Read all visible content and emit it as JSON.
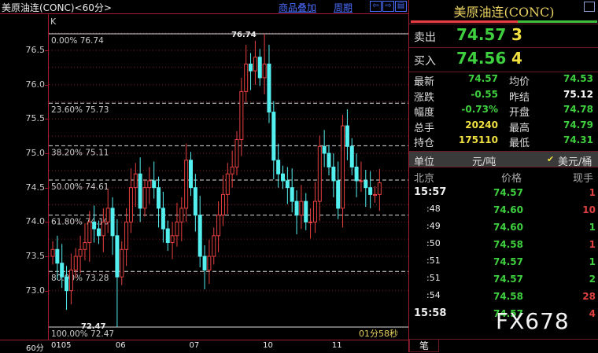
{
  "header": {
    "title": "美原油连(CONC)<60分>",
    "overlay_link": "商品叠加",
    "period_link": "周期",
    "nav": [
      "⇦",
      "⇨",
      "▤"
    ]
  },
  "chart": {
    "indicator_label": "K",
    "y_ticks": [
      "76.5",
      "76.0",
      "75.5",
      "75.0",
      "74.5",
      "74.0",
      "73.5",
      "73.0"
    ],
    "y_tick_values": [
      76.5,
      76.0,
      75.5,
      75.0,
      74.5,
      74.0,
      73.5,
      73.0
    ],
    "fib_levels": [
      {
        "label": "0.00% 76.74",
        "price": 76.74
      },
      {
        "label": "23.60% 75.73",
        "price": 75.73
      },
      {
        "label": "38.20% 75.11",
        "price": 75.11
      },
      {
        "label": "50.00% 74.61",
        "price": 74.61
      },
      {
        "label": "61.80% 74.10",
        "price": 74.1
      },
      {
        "label": "80.90% 73.28",
        "price": 73.28
      },
      {
        "label": "100.00% 72.47",
        "price": 72.47
      }
    ],
    "high_marker": "76.74",
    "low_marker": "72.47",
    "high_price": 76.74,
    "low_price": 72.47,
    "high_index": 46,
    "low_index": 14,
    "countdown": "01分58秒",
    "period": "60分",
    "x_labels": [
      {
        "text": "0105",
        "index": 0
      },
      {
        "text": "06",
        "index": 14
      },
      {
        "text": "07",
        "index": 30
      },
      {
        "text": "10",
        "index": 46
      },
      {
        "text": "11",
        "index": 61
      }
    ],
    "open0": 73.5,
    "closes": [
      73.6,
      73.4,
      73.2,
      73.0,
      73.3,
      73.5,
      73.6,
      73.7,
      74.0,
      73.9,
      73.8,
      74.0,
      74.2,
      73.8,
      73.2,
      73.6,
      74.0,
      74.5,
      74.7,
      74.2,
      74.5,
      74.6,
      74.5,
      74.2,
      73.9,
      73.7,
      73.8,
      74.0,
      74.2,
      74.9,
      74.5,
      74.1,
      73.5,
      73.3,
      73.5,
      73.8,
      74.1,
      74.4,
      74.7,
      74.8,
      75.2,
      75.9,
      76.3,
      76.2,
      76.4,
      76.1,
      76.3,
      75.6,
      74.9,
      74.7,
      74.6,
      74.5,
      74.3,
      74.1,
      74.3,
      74.0,
      74.0,
      74.3,
      75.1,
      75.0,
      74.8,
      74.6,
      74.2,
      75.4,
      75.1,
      74.8,
      74.6,
      74.6,
      74.5,
      74.4,
      74.4,
      74.57
    ],
    "up_color": "#e84040",
    "down_color": "#54f0f0"
  },
  "quote": {
    "name": "美原油连(CONC)",
    "ask_label": "卖出",
    "ask_price": "74.57",
    "ask_vol": "3",
    "bid_label": "买入",
    "bid_price": "74.56",
    "bid_vol": "4",
    "stats": [
      {
        "l1": "最新",
        "v1": "74.57",
        "c1": "g",
        "l2": "均价",
        "v2": "74.53",
        "c2": "g"
      },
      {
        "l1": "涨跌",
        "v1": "-0.55",
        "c1": "g",
        "l2": "昨结",
        "v2": "75.12",
        "c2": "w"
      },
      {
        "l1": "幅度",
        "v1": "-0.73%",
        "c1": "g",
        "l2": "开盘",
        "v2": "74.78",
        "c2": "g"
      },
      {
        "l1": "总手",
        "v1": "20240",
        "c1": "y",
        "l2": "最高",
        "v2": "74.79",
        "c2": "g"
      },
      {
        "l1": "持仓",
        "v1": "175110",
        "c1": "y",
        "l2": "最低",
        "v2": "74.31",
        "c2": "g"
      }
    ],
    "unit_label": "单位",
    "unit_opt1": "元/吨",
    "unit_opt2": "美元/桶",
    "check": "✔",
    "ticks_header": [
      "北京",
      "价格",
      "现手"
    ],
    "ticks": [
      {
        "t": "15:57",
        "p": "74.57",
        "v": "1",
        "vc": "r",
        "big": true
      },
      {
        "t": ":48",
        "p": "74.60",
        "v": "10",
        "vc": "r",
        "big": false
      },
      {
        "t": ":49",
        "p": "74.60",
        "v": "1",
        "vc": "g",
        "big": false
      },
      {
        "t": ":50",
        "p": "74.58",
        "v": "1",
        "vc": "r",
        "big": false
      },
      {
        "t": ":51",
        "p": "74.57",
        "v": "1",
        "vc": "g",
        "big": false
      },
      {
        "t": ":51",
        "p": "74.57",
        "v": "2",
        "vc": "g",
        "big": false
      },
      {
        "t": ":54",
        "p": "74.58",
        "v": "28",
        "vc": "r",
        "big": false
      },
      {
        "t": "15:58",
        "p": "74.57",
        "v": "4",
        "vc": "r",
        "big": true
      }
    ],
    "tab": "笔"
  },
  "watermark": "FX678"
}
